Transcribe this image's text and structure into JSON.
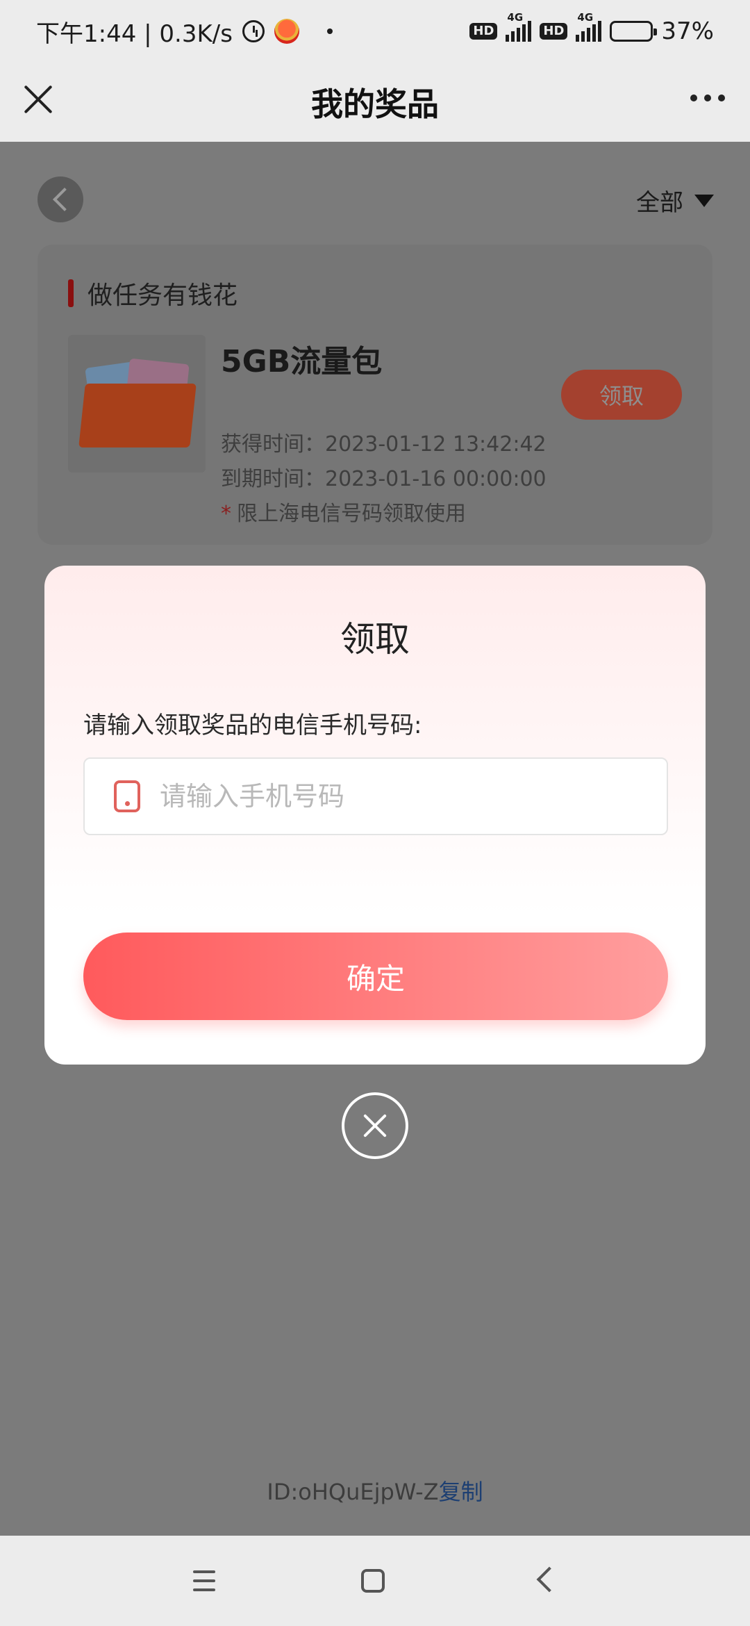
{
  "status_bar": {
    "time_speed": "下午1:44 | 0.3K/s",
    "hd1": "HD",
    "net1": "4G",
    "hd2": "HD",
    "net2": "4G",
    "battery": "37%"
  },
  "header": {
    "title": "我的奖品"
  },
  "filter": {
    "label": "全部"
  },
  "prize": {
    "section_title": "做任务有钱花",
    "name": "5GB流量包",
    "claim_label": "领取",
    "obtain_time": "获得时间：2023-01-12 13:42:42",
    "expire_time": "到期时间：2023-01-16 00:00:00",
    "note_star": "*",
    "note": "限上海电信号码领取使用"
  },
  "footer": {
    "id_text": "ID:oHQuEjpW-Z",
    "copy_label": "复制"
  },
  "modal": {
    "title": "领取",
    "label": "请输入领取奖品的电信手机号码:",
    "input_placeholder": "请输入手机号码",
    "input_value": "",
    "confirm_label": "确定"
  },
  "colors": {
    "accent": "#ff5a5c",
    "accent_light": "#ff9e9e",
    "overlay": "#7b7b7b",
    "link": "#1d3f72"
  },
  "icons": {
    "status": [
      "alarm-icon",
      "app-logo-icon",
      "signal-icon",
      "battery-icon"
    ],
    "header": [
      "close-icon",
      "more-icon"
    ],
    "page": [
      "back-icon",
      "dropdown-triangle-icon",
      "phone-icon",
      "close-circle-icon"
    ],
    "navbar": [
      "menu-icon",
      "home-icon",
      "back-icon"
    ]
  }
}
